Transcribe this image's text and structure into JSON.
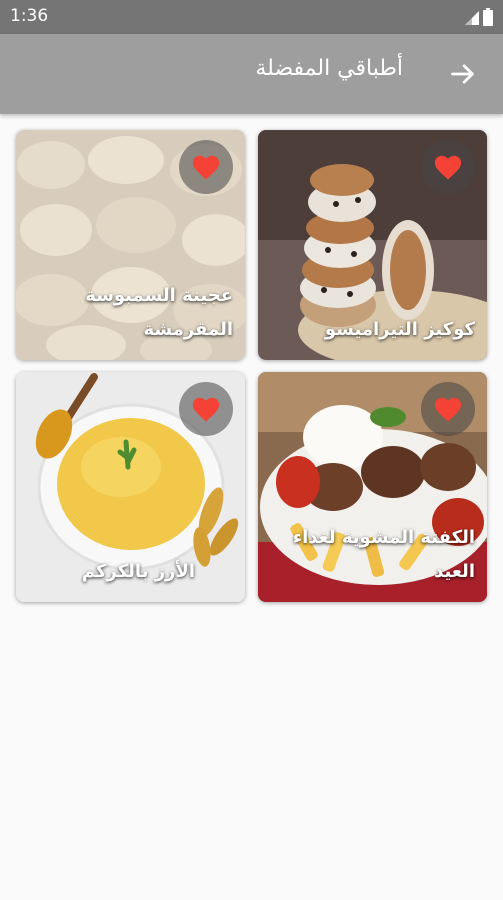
{
  "status_bar": {
    "time": "1:36",
    "icons": [
      "signal-icon",
      "battery-icon"
    ]
  },
  "app_bar": {
    "title": "أطباقي المفضلة",
    "back_icon": "arrow-right-icon"
  },
  "recipes": [
    {
      "title": "كوكيز التيراميسو",
      "favorite": true
    },
    {
      "title": "عجينة السمبوسة المقرمشة",
      "favorite": true
    },
    {
      "title": "الكفتة المشوية لغداء العيد",
      "favorite": true
    },
    {
      "title": "الأرز بالكركم",
      "favorite": true
    }
  ],
  "colors": {
    "status_bar": "#757575",
    "app_bar": "#9e9e9e",
    "heart": "#f44336",
    "background": "#fafafa"
  }
}
